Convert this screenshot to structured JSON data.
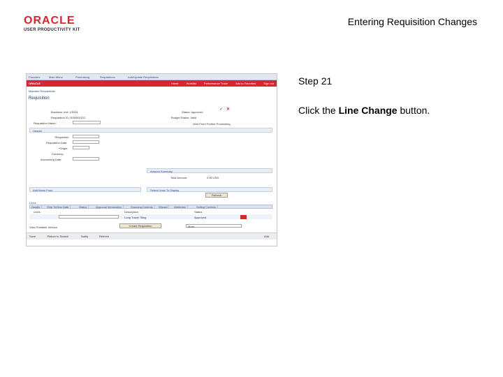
{
  "logo": {
    "brand": "ORACLE",
    "product": "USER PRODUCTIVITY KIT"
  },
  "slide": {
    "title": "Entering Requisition Changes",
    "step": "Step 21",
    "instruction_prefix": "Click the ",
    "instruction_bold": "Line Change",
    "instruction_suffix": " button."
  },
  "screenshot": {
    "nav": [
      "Favorites",
      "Main Menu",
      "Purchasing",
      "Requisitions",
      "Add/Update Requisitions"
    ],
    "header_links": [
      "Home",
      "Worklist",
      "Performance Trace",
      "Add to Favorites",
      "Sign out"
    ],
    "breadcrumb": "Maintain Requisitions",
    "page_title": "Requisition",
    "labels": {
      "business_unit": "Business Unit: US001",
      "requisition_id": "Requisition ID: 0000000212",
      "requisition_name": "Requisition Name:",
      "status": "Status: Approved",
      "budget_status": "Budget Status: Valid",
      "lock_header": "Hold From Further Processing",
      "header_section": "Header",
      "requester": "*Requester:",
      "requisition_date": "Requisition Date:",
      "origin": "*Origin:",
      "currency": "Currency:",
      "accounting_date": "Accounting Date:",
      "amount_summary": "Amount Summary",
      "total_amount": "Total Amount:",
      "total_value": "0.00 USD",
      "add_items": "Add Items From",
      "select_lines": "Select Lines To Display",
      "refresh": "Refresh",
      "lines": "Lines",
      "description": "Description",
      "status_col": "Status",
      "line_value": "Long Travel Tiling",
      "line_status": "Approved",
      "view_printable": "View Printable Version",
      "create_requisition": "Create Requisition",
      "more": "More..."
    },
    "tabs": [
      "Details",
      "Ship To/Due Date",
      "Status",
      "Approval Information",
      "Sourcing Controls",
      "Wizard",
      "Attributes",
      "Selling Controls"
    ],
    "footer": [
      "Save",
      "Return to Search",
      "Notify",
      "Refresh"
    ],
    "footer_right": [
      "Add"
    ]
  },
  "colors": {
    "oracle_red": "#d8262e",
    "link_blue": "#2a4b8a",
    "section_bg": "#e8eef6"
  },
  "icons": [
    "approve-check-icon",
    "delete-x-icon",
    "calendar-icon",
    "lookup-icon"
  ]
}
